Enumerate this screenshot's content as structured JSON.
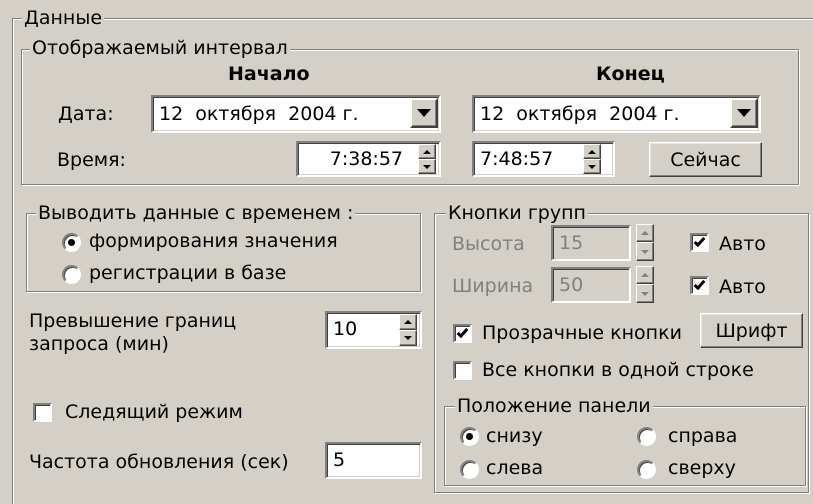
{
  "data_group": {
    "title": "Данные"
  },
  "interval_group": {
    "title": "Отображаемый интервал",
    "start_header": "Начало",
    "end_header": "Конец",
    "date_label": "Дата:",
    "time_label": "Время:",
    "start_date": "12  октября  2004 г.",
    "end_date": "12  октября  2004 г.",
    "start_time": "7:38:57",
    "end_time": "7:48:57",
    "now_button": "Сейчас"
  },
  "output_group": {
    "title": "Выводить данные с временем :",
    "options": [
      {
        "label": "формирования значения",
        "selected": true
      },
      {
        "label": "регистрации в базе",
        "selected": false
      }
    ]
  },
  "excess": {
    "label_line1": "Превышение границ",
    "label_line2": "запроса (мин)",
    "value": "10"
  },
  "follow_mode": {
    "label": "Следящий режим",
    "checked": false
  },
  "refresh": {
    "label": "Частота обновления (сек)",
    "value": "5"
  },
  "button_groups": {
    "title": "Кнопки групп",
    "height_label": "Высота",
    "height_value": "15",
    "height_auto": {
      "label": "Авто",
      "checked": true
    },
    "width_label": "Ширина",
    "width_value": "50",
    "width_auto": {
      "label": "Авто",
      "checked": true
    },
    "transparent": {
      "label": "Прозрачные кнопки",
      "checked": true
    },
    "font_button": "Шрифт",
    "one_row": {
      "label": "Все кнопки в одной строке",
      "checked": false
    }
  },
  "panel_position": {
    "title": "Положение панели",
    "options": [
      {
        "label": "снизу",
        "selected": true
      },
      {
        "label": "справа",
        "selected": false
      },
      {
        "label": "слева",
        "selected": false
      },
      {
        "label": "сверху",
        "selected": false
      }
    ]
  }
}
